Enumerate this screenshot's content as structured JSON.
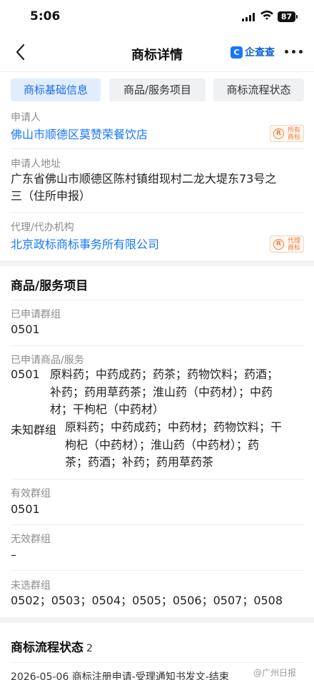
{
  "status": {
    "time": "5:06",
    "battery": "87"
  },
  "nav": {
    "title": "商标详情",
    "brand_icon_text": "C",
    "brand_text": "企查查"
  },
  "tabs": [
    {
      "label": "商标基础信息",
      "active": true
    },
    {
      "label": "商品/服务项目",
      "active": false
    },
    {
      "label": "商标流程状态",
      "active": false
    }
  ],
  "applicant": {
    "label": "申请人",
    "value": "佛山市顺德区莫赞荣餐饮店",
    "badge_line1": "所有",
    "badge_line2": "商标"
  },
  "address": {
    "label": "申请人地址",
    "line1": "广东省佛山市顺德区陈村镇绀现村二龙大堤东73号之",
    "line2": "三（住所申报）"
  },
  "agent": {
    "label": "代理/代办机构",
    "value": "北京政标商标事务所有限公司",
    "badge_line1": "代理",
    "badge_line2": "商标"
  },
  "goods": {
    "title": "商品/服务项目",
    "applied_group_label": "已申请群组",
    "applied_group_value": "0501",
    "applied_goods_label": "已申请商品/服务",
    "group1_code": "0501",
    "group1_lines": [
      "原料药；中药成药；药茶；药物饮料；药酒；",
      "补药；药用草药茶；淮山药（中药材）；中药",
      "材；干枸杞（中药材）"
    ],
    "group2_code": "未知群组",
    "group2_lines": [
      "原料药；中药成药；中药材；药物饮料；干",
      "枸杞（中药材）；淮山药（中药材）；药",
      "茶；药酒；补药；药用草药茶"
    ],
    "valid_label": "有效群组",
    "valid_value": "0501",
    "invalid_label": "无效群组",
    "invalid_value": "–",
    "unselected_label": "未选群组",
    "unselected_value": "0502；0503；0504；0505；0506；0507；0508"
  },
  "process": {
    "title": "商标流程状态",
    "count": "2",
    "first_item": "2026-05-06 商标注册申请-受理通知书发文-结束"
  },
  "watermark": "@广州日报"
}
